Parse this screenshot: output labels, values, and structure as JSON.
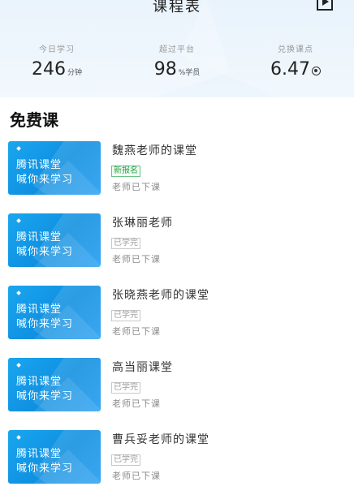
{
  "header": {
    "title": "课程表",
    "stats": [
      {
        "label": "今日学习",
        "value": "246",
        "unit": "分钟"
      },
      {
        "label": "超过平台",
        "value": "98",
        "unit": "%学员"
      },
      {
        "label": "兑换课点",
        "value": "6.47",
        "unit_icon": "coin-icon"
      }
    ]
  },
  "section": {
    "title": "免费课"
  },
  "thumbnail": {
    "line1": "腾讯课堂",
    "line2": "喊你来学习"
  },
  "courses": [
    {
      "name": "魏燕老师的课堂",
      "badge": "新报名",
      "badge_type": "new",
      "status": "老师已下课"
    },
    {
      "name": "张琳丽老师",
      "badge": "已学完",
      "badge_type": "done",
      "status": "老师已下课"
    },
    {
      "name": "张晓燕老师的课堂",
      "badge": "已学完",
      "badge_type": "done",
      "status": "老师已下课"
    },
    {
      "name": "高当丽课堂",
      "badge": "已学完",
      "badge_type": "done",
      "status": "老师已下课"
    },
    {
      "name": "曹兵妥老师的课堂",
      "badge": "已学完",
      "badge_type": "done",
      "status": "老师已下课"
    }
  ],
  "colors": {
    "accent": "#1aa6ef",
    "badge_new": "#2ea24a",
    "header_bg": "#e3f0fb"
  }
}
